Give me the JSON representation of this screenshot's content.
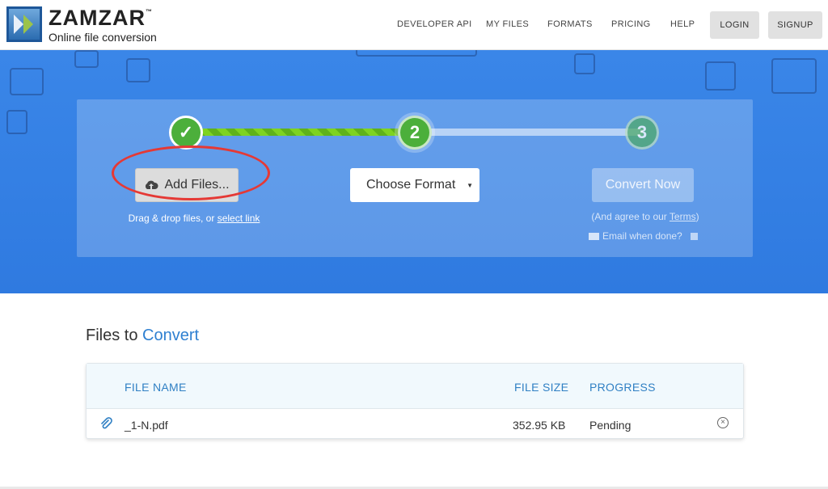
{
  "header": {
    "brand": "ZAMZAR",
    "trademark": "™",
    "tagline": "Online file conversion",
    "nav": [
      "DEVELOPER API",
      "MY FILES",
      "FORMATS",
      "PRICING",
      "HELP"
    ],
    "login_label": "LOGIN",
    "signup_label": "SIGNUP"
  },
  "steps": {
    "step1_symbol": "✓",
    "step2_number": "2",
    "step3_number": "3",
    "add_files_label": "Add Files...",
    "drag_text": "Drag & drop files, or",
    "select_link": "select link",
    "format_label": "Choose Format",
    "format_arrow": "▼",
    "convert_label": "Convert Now",
    "agree_prefix": "(And agree to our",
    "terms_link": "Terms",
    "agree_suffix": ")",
    "email_label": "Email when done?"
  },
  "files": {
    "title_prefix": "Files to",
    "title_accent": "Convert",
    "columns": {
      "name": "FILE NAME",
      "size": "FILE SIZE",
      "progress": "PROGRESS"
    },
    "rows": [
      {
        "name": "_1-N.pdf",
        "size": "352.95 KB",
        "progress": "Pending"
      }
    ]
  },
  "colors": {
    "hero_blue": "#2f7ae0",
    "accent_blue": "#2f80d1",
    "step_green": "#4caf3b",
    "highlight_red": "#e53935"
  }
}
